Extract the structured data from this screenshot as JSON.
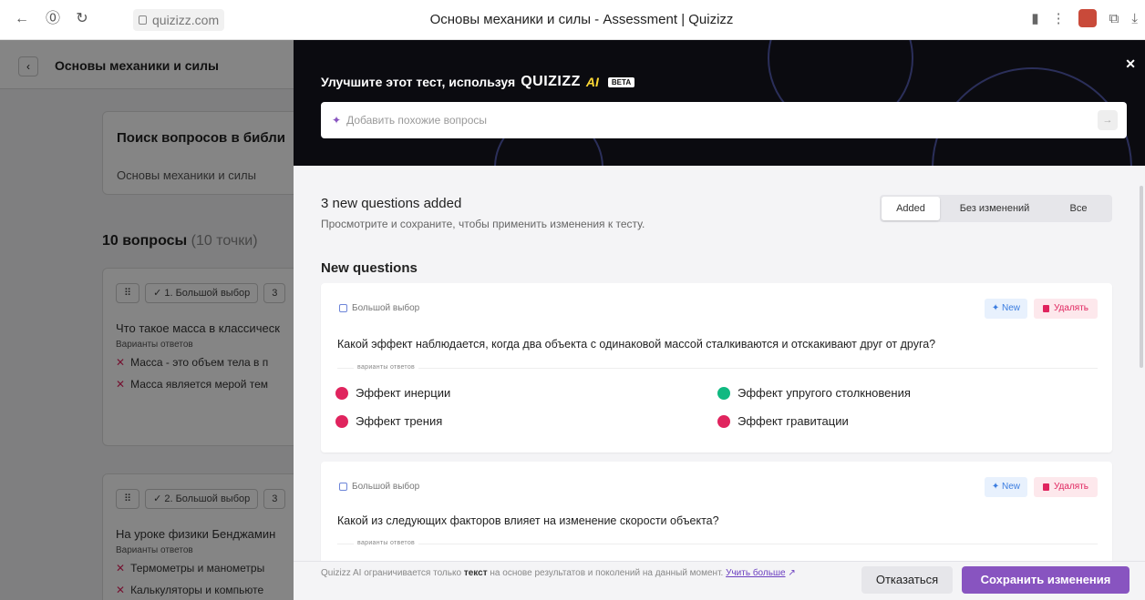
{
  "browser": {
    "url": "quizizz.com",
    "tab_title": "Основы механики и силы - Assessment | Quizizz"
  },
  "background": {
    "page_title": "Основы механики и силы",
    "search_heading": "Поиск вопросов в библи",
    "search_value": "Основы механики и силы",
    "count_label": "10 вопросы",
    "points_label": "(10 точки)",
    "questions": [
      {
        "tag": "✓ 1. Большой выбор",
        "tag_suffix": "3",
        "text": "Что такое масса в классическ",
        "answers_label": "Варианты ответов",
        "answers": [
          "Масса - это объем тела в п",
          "Масса является мерой тем"
        ]
      },
      {
        "tag": "✓ 2. Большой выбор",
        "tag_suffix": "3",
        "text": "На уроке физики Бенджамин",
        "answers_label": "Варианты ответов",
        "answers": [
          "Термометры и манометры",
          "Калькуляторы и компьюте"
        ]
      }
    ]
  },
  "modal": {
    "heading": "Улучшите этот тест, используя",
    "logo": "QUIZIZZ",
    "ai": "AI",
    "beta": "BETA",
    "input_placeholder": "Добавить похожие вопросы",
    "summary_title": "3 new questions added",
    "summary_sub": "Просмотрите и сохраните, чтобы применить изменения к тесту.",
    "filters": [
      "Added",
      "Без изменений",
      "Все"
    ],
    "section_title": "New questions",
    "questions": [
      {
        "type": "Большой выбор",
        "badge": "New",
        "delete": "Удалять",
        "text": "Какой эффект наблюдается, когда два объекта с одинаковой массой сталкиваются и отскакивают друг от друга?",
        "answers_label": "варианты ответов",
        "options": [
          {
            "text": "Эффект инерции",
            "correct": false
          },
          {
            "text": "Эффект упругого столкновения",
            "correct": true
          },
          {
            "text": "Эффект трения",
            "correct": false
          },
          {
            "text": "Эффект гравитации",
            "correct": false
          }
        ]
      },
      {
        "type": "Большой выбор",
        "badge": "New",
        "delete": "Удалять",
        "text": "Какой из следующих факторов влияет на изменение скорости объекта?",
        "answers_label": "варианты ответов"
      }
    ],
    "footer": {
      "disclaimer_pre": "Quizizz AI ограничивается только",
      "disclaimer_bold": "текст",
      "disclaimer_post": "на основе результатов и поколений на данный момент.",
      "learn_more": "Учить больше",
      "cancel": "Отказаться",
      "save": "Сохранить изменения"
    }
  },
  "colors": {
    "accent": "#8854c0",
    "correct": "#10b981",
    "wrong": "#e0245e",
    "header_bg": "#0b0b10"
  }
}
